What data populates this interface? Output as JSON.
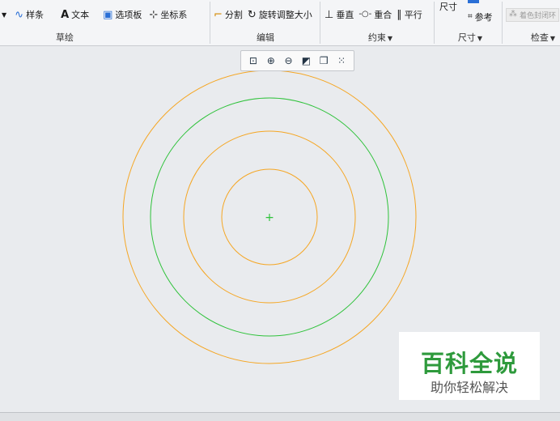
{
  "ribbon": {
    "sketch_group": {
      "label": "草绘",
      "tools": [
        {
          "label": "样条",
          "icon": "spline-icon"
        },
        {
          "label": "文本",
          "icon": "text-icon"
        },
        {
          "label": "选项板",
          "icon": "palette-icon"
        },
        {
          "label": "坐标系",
          "icon": "coordinate-system-icon"
        }
      ]
    },
    "edit_group": {
      "label": "编辑",
      "tools": [
        {
          "label": "分割",
          "icon": "divide-icon"
        },
        {
          "label": "旋转调整大小",
          "icon": "rotate-resize-icon"
        }
      ]
    },
    "constraint_group": {
      "label": "约束",
      "tools": [
        {
          "label": "垂直",
          "icon": "perpendicular-icon"
        },
        {
          "label": "重合",
          "icon": "coincident-icon"
        },
        {
          "label": "平行",
          "icon": "parallel-icon"
        }
      ]
    },
    "dimension_group": {
      "label": "尺寸",
      "top_label": "尺寸",
      "tools": [
        {
          "label": "参考",
          "icon": "reference-icon"
        }
      ]
    },
    "inspect_group": {
      "label": "检查",
      "tools": [
        {
          "label": "着色封闭环",
          "icon": "shade-closed-loops-icon"
        }
      ]
    }
  },
  "mini_toolbar": {
    "buttons": [
      "refit-icon",
      "zoom-in-icon",
      "zoom-out-icon",
      "display-style-icon",
      "saved-orientations-icon",
      "sketcher-display-icon"
    ]
  },
  "sketch": {
    "colors": {
      "orange": "#f5a623",
      "green": "#2ec23a"
    },
    "center_mark": "+"
  },
  "watermark": {
    "title": "百科全说",
    "subtitle": "助你轻松解决"
  }
}
